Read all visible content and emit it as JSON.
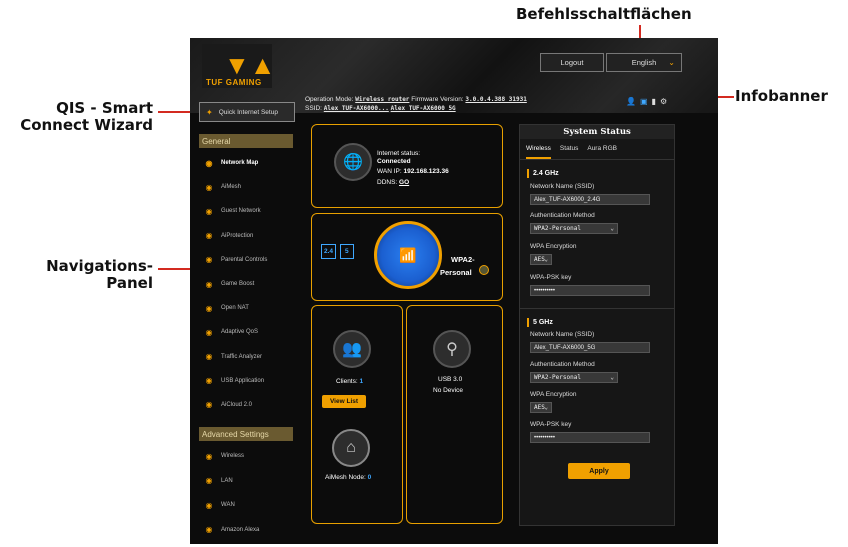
{
  "callouts": {
    "buttons": "Befehlsschaltflächen",
    "banner": "Infobanner",
    "qis_line1": "QIS - Smart",
    "qis_line2": "Connect Wizard",
    "nav_line1": "Navigations-",
    "nav_line2": "Panel"
  },
  "brand": {
    "logo_text": "TUF GAMING"
  },
  "top_buttons": {
    "logout": "Logout",
    "language": "English"
  },
  "banner": {
    "op_mode_label": "Operation Mode:",
    "op_mode_value": "Wireless router",
    "fw_label": "Firmware Version:",
    "fw_value": "3.0.0.4.388_31931",
    "ssid_label": "SSID:",
    "ssid_1": "Alex_TUF-AX6000...",
    "ssid_2": "Alex_TUF-AX6000_5G"
  },
  "sidebar": {
    "qis_label": "Quick Internet Setup",
    "general_header": "General",
    "general_items": [
      {
        "label": "Network Map",
        "icon": "network-map-icon"
      },
      {
        "label": "AiMesh",
        "icon": "aimesh-icon"
      },
      {
        "label": "Guest Network",
        "icon": "guest-network-icon"
      },
      {
        "label": "AiProtection",
        "icon": "shield-icon"
      },
      {
        "label": "Parental Controls",
        "icon": "parental-icon"
      },
      {
        "label": "Game Boost",
        "icon": "rocket-icon"
      },
      {
        "label": "Open NAT",
        "icon": "open-nat-icon"
      },
      {
        "label": "Adaptive QoS",
        "icon": "qos-icon"
      },
      {
        "label": "Traffic Analyzer",
        "icon": "traffic-icon"
      },
      {
        "label": "USB Application",
        "icon": "usb-app-icon"
      },
      {
        "label": "AiCloud 2.0",
        "icon": "cloud-icon"
      }
    ],
    "advanced_header": "Advanced Settings",
    "advanced_items": [
      {
        "label": "Wireless",
        "icon": "wireless-icon"
      },
      {
        "label": "LAN",
        "icon": "lan-icon"
      },
      {
        "label": "WAN",
        "icon": "wan-icon"
      },
      {
        "label": "Amazon Alexa",
        "icon": "alexa-icon"
      }
    ]
  },
  "map": {
    "internet_status_label": "Internet status:",
    "internet_status_value": "Connected",
    "wan_ip_label": "WAN IP:",
    "wan_ip_value": "192.168.123.36",
    "ddns_label": "DDNS:",
    "ddns_value": "GO",
    "band_24": "2.4",
    "band_5": "5",
    "security_line1": "WPA2-",
    "security_line2": "Personal",
    "clients_label": "Clients:",
    "clients_value": "1",
    "view_list": "View List",
    "usb_label": "USB 3.0",
    "usb_status": "No Device",
    "aimesh_label": "AiMesh Node:",
    "aimesh_value": "0"
  },
  "status": {
    "title": "System Status",
    "tabs": [
      "Wireless",
      "Status",
      "Aura RGB"
    ],
    "band24": {
      "title": "2.4 GHz",
      "ssid_label": "Network Name (SSID)",
      "ssid_value": "Alex_TUF-AX6000_2.4G",
      "auth_label": "Authentication Method",
      "auth_value": "WPA2-Personal",
      "enc_label": "WPA Encryption",
      "enc_value": "AES",
      "psk_label": "WPA-PSK key",
      "psk_value": "••••••••••"
    },
    "band5": {
      "title": "5 GHz",
      "ssid_label": "Network Name (SSID)",
      "ssid_value": "Alex_TUF-AX6000_5G",
      "auth_label": "Authentication Method",
      "auth_value": "WPA2-Personal",
      "enc_label": "WPA Encryption",
      "enc_value": "AES",
      "psk_label": "WPA-PSK key",
      "psk_value": "••••••••••"
    },
    "apply": "Apply"
  },
  "colors": {
    "accent": "#f0a000",
    "callout_line": "#d32a20",
    "router_blue": "#1b5fd0"
  }
}
